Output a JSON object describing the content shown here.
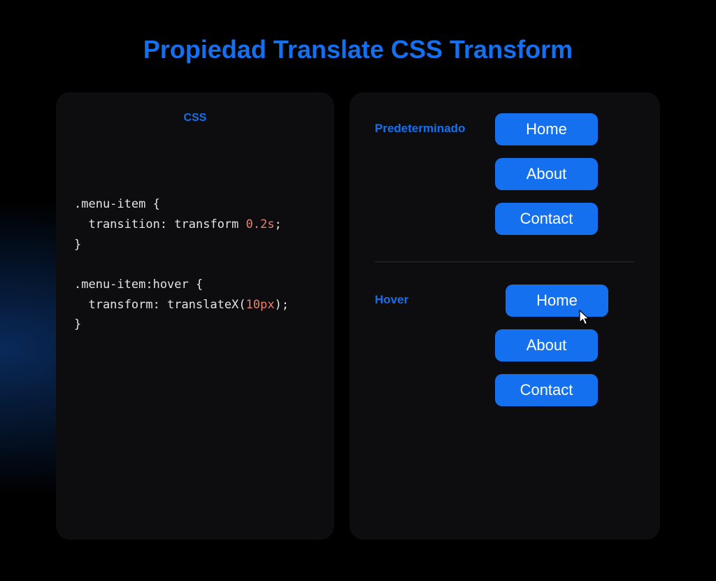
{
  "title": "Propiedad Translate CSS Transform",
  "leftPanel": {
    "label": "CSS",
    "code": {
      "rule1": {
        "open": ".menu-item {",
        "prop_indent": "  transition: transform ",
        "value": "0.2s",
        "value_suffix": ";",
        "close": "}"
      },
      "rule2": {
        "open": ".menu-item:hover {",
        "prop_indent": "  transform: translateX(",
        "value": "10px",
        "value_suffix": ");",
        "close": "}"
      }
    }
  },
  "rightPanel": {
    "defaultSection": {
      "label": "Predeterminado",
      "buttons": [
        "Home",
        "About",
        "Contact"
      ]
    },
    "hoverSection": {
      "label": "Hover",
      "buttons": [
        "Home",
        "About",
        "Contact"
      ]
    }
  }
}
